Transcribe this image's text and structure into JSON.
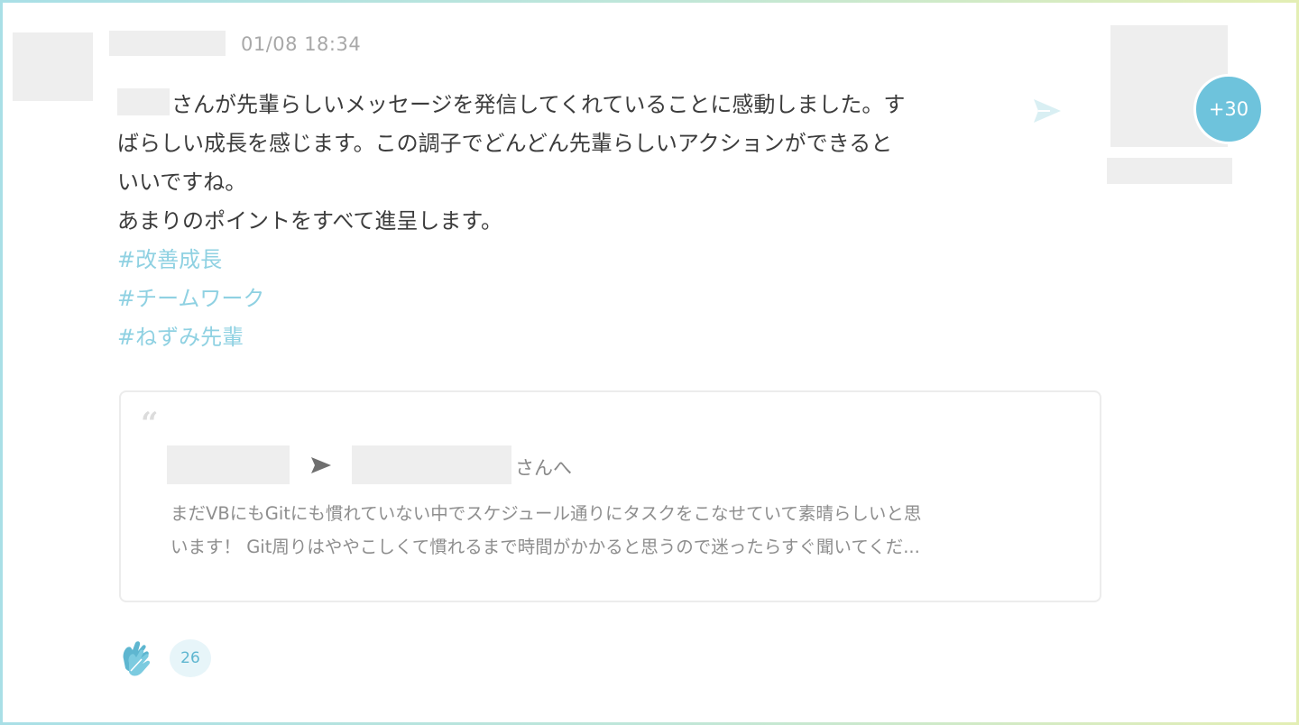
{
  "post": {
    "timestamp": "01/08 18:34",
    "message_line1_rest": "さんが先輩らしいメッセージを発信してくれていることに感動しました。す",
    "message_line2": "ばらしい成長を感じます。この調子でどんどん先輩らしいアクションができると",
    "message_line3": "いいですね。",
    "message_line4": "あまりのポイントをすべて進呈します。",
    "hashtags": [
      "#改善成長",
      "#チームワーク",
      "#ねずみ先輩"
    ],
    "more_recipients_badge": "+30"
  },
  "quote": {
    "recipient_suffix": "さんへ",
    "text_line1": "まだVBにもGitにも慣れていない中でスケジュール通りにタスクをこなせていて素晴らしいと思",
    "text_line2": "います！ Git周りはややこしくて慣れるまで時間がかかると思うので迷ったらすぐ聞いてくだ..."
  },
  "reactions": {
    "clap_count": "26"
  },
  "icons": {
    "send": "paper-plane-icon",
    "quote": "quote-mark-icon",
    "arrow": "arrow-right-icon",
    "clap": "clapping-hands-icon"
  },
  "colors": {
    "accent": "#6ec3dc",
    "hashtag": "#8fd1e2",
    "send_icon": "#d9eff3"
  }
}
